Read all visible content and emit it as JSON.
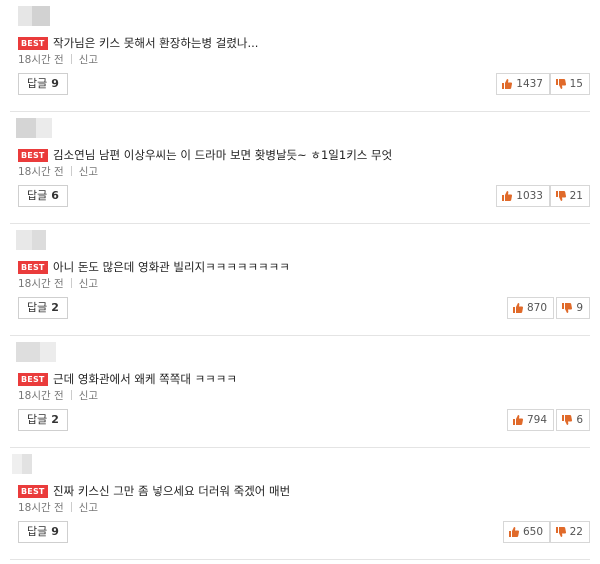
{
  "best_label": "BEST",
  "time_ago": "18시간 전",
  "report_label": "신고",
  "reply_label": "답글",
  "colors": {
    "best_badge": "#ea3b3b",
    "like_icon": "#e06a2a",
    "dislike_icon": "#e06a2a"
  },
  "icons": [
    "avatar-placeholder",
    "thumbs-up-icon",
    "thumbs-down-icon"
  ],
  "comments": [
    {
      "text": "작가님은 키스 못해서 환장하는병 걸렸나...",
      "replies": "9",
      "likes": "1437",
      "dislikes": "15"
    },
    {
      "text": "김소연님 남편 이상우씨는 이 드라마 보면 홧병날듯~ ㅎ1일1키스 무엇",
      "replies": "6",
      "likes": "1033",
      "dislikes": "21"
    },
    {
      "text": "아니 돈도 많은데 영화관 빌리지ㅋㅋㅋㅋㅋㅋㅋㅋ",
      "replies": "2",
      "likes": "870",
      "dislikes": "9"
    },
    {
      "text": "근데 영화관에서 왜케 쪽쪽대 ㅋㅋㅋㅋ",
      "replies": "2",
      "likes": "794",
      "dislikes": "6"
    },
    {
      "text": "진짜 키스신 그만 좀 넣으세요 더러워 죽겠어 매번",
      "replies": "9",
      "likes": "650",
      "dislikes": "22"
    }
  ]
}
